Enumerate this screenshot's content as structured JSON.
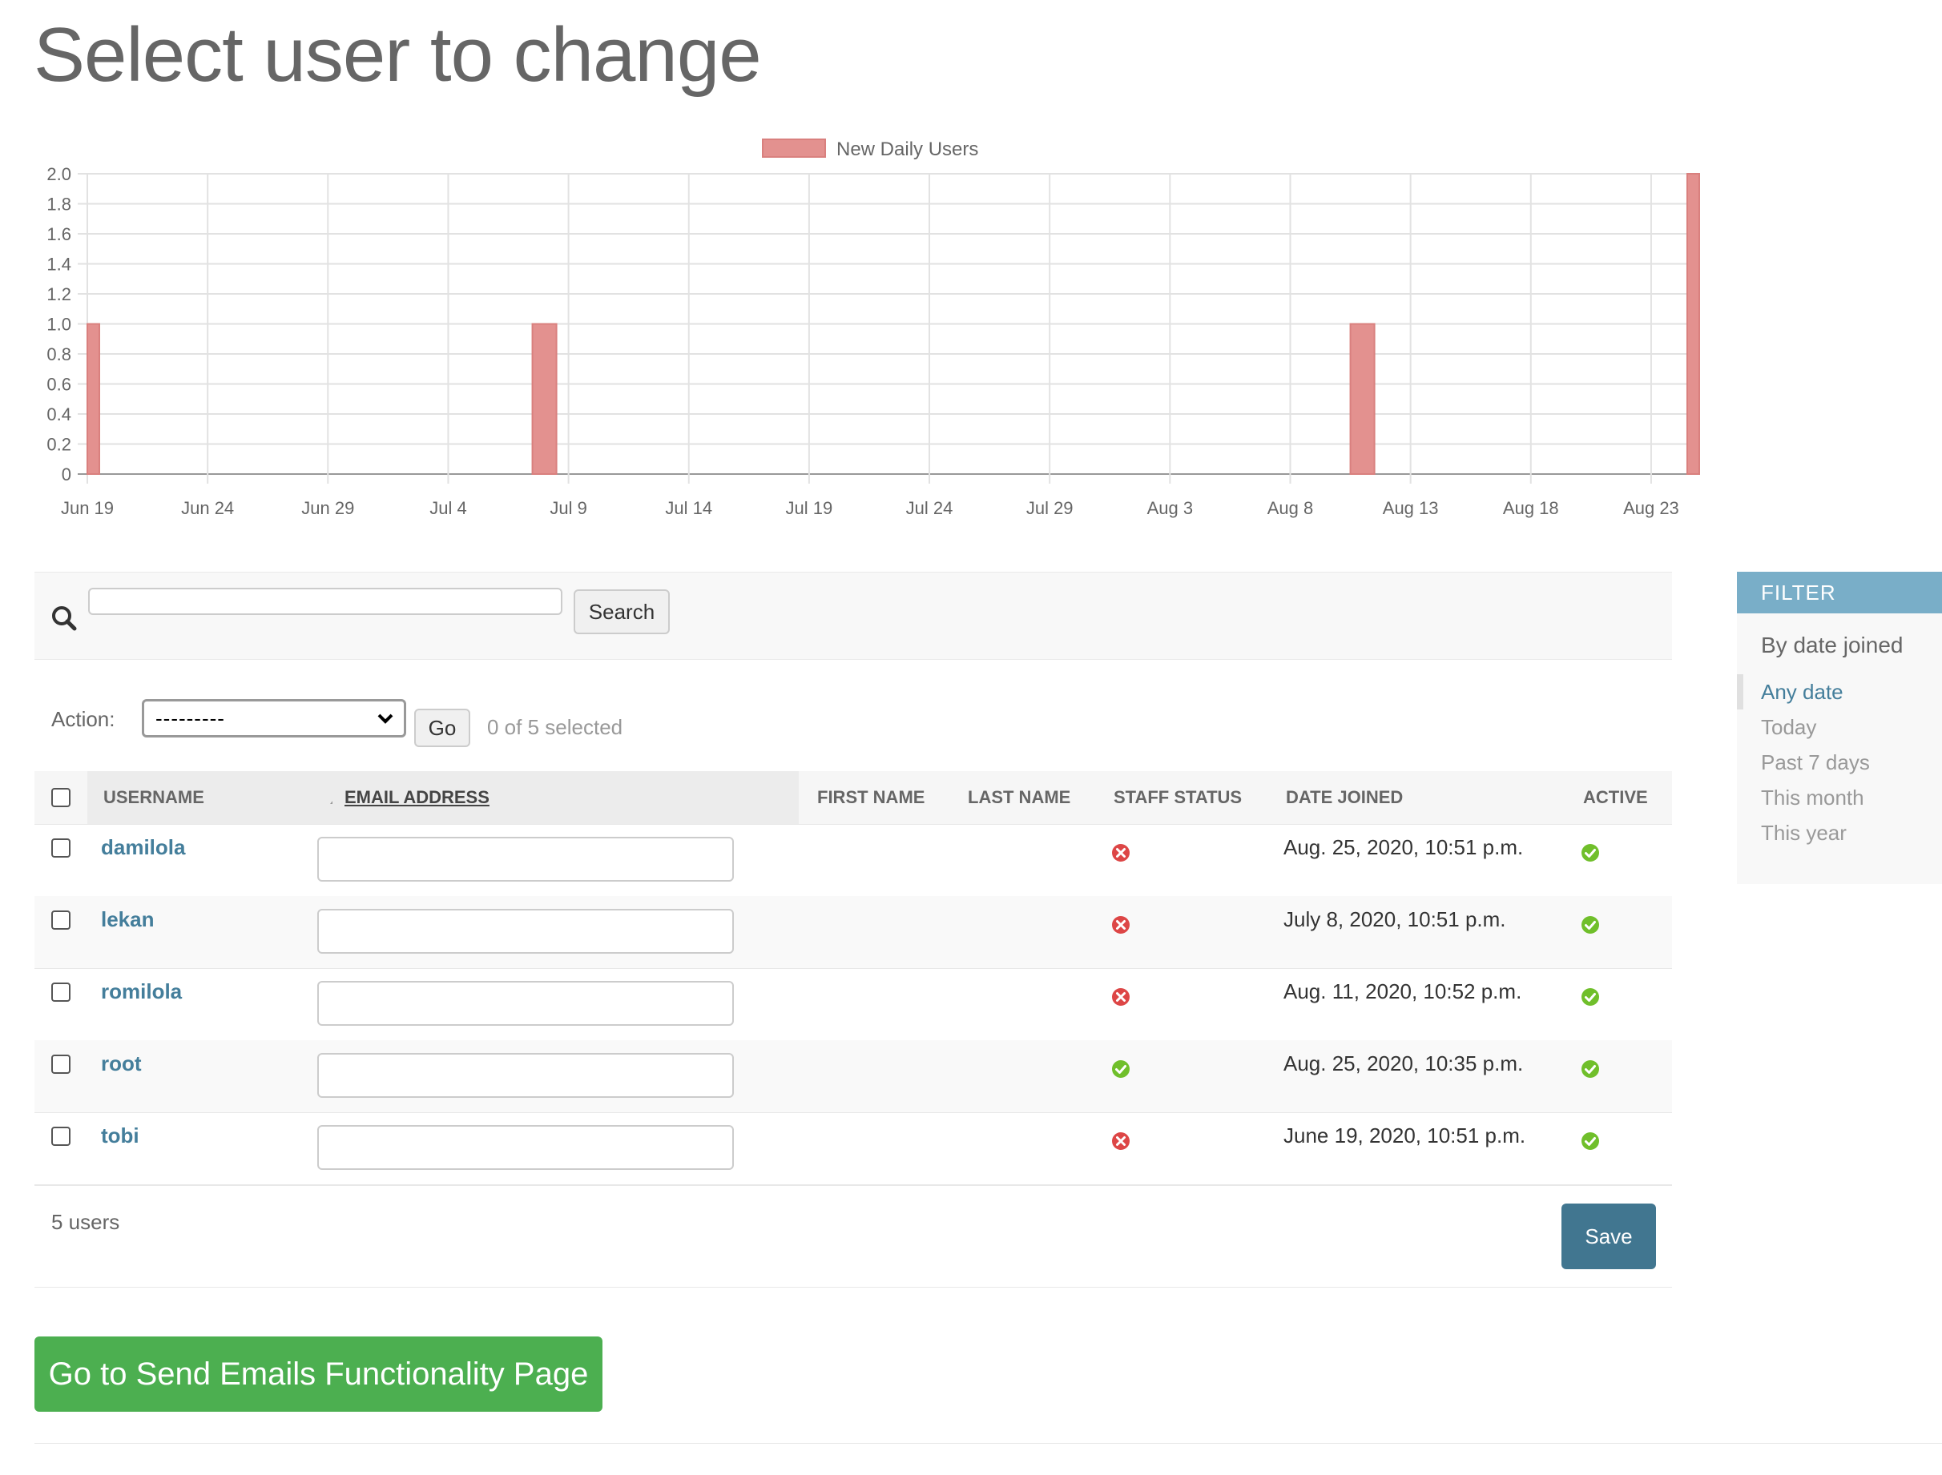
{
  "page": {
    "title": "Select user to change"
  },
  "chart_data": {
    "type": "bar",
    "title": "",
    "legend": [
      "New Daily Users"
    ],
    "legend_position": "top-center",
    "x_tick_labels": [
      "Jun 19",
      "Jun 24",
      "Jun 29",
      "Jul 4",
      "Jul 9",
      "Jul 14",
      "Jul 19",
      "Jul 24",
      "Jul 29",
      "Aug 3",
      "Aug 8",
      "Aug 13",
      "Aug 18",
      "Aug 23"
    ],
    "y_tick_labels": [
      "0",
      "0.2",
      "0.4",
      "0.6",
      "0.8",
      "1.0",
      "1.2",
      "1.4",
      "1.6",
      "1.8",
      "2.0"
    ],
    "ylim": [
      0,
      2.0
    ],
    "grid": true,
    "color": "#e3918f",
    "series": [
      {
        "name": "New Daily Users",
        "points": [
          {
            "x": "Jun 19",
            "y": 1
          },
          {
            "x": "Jul 8",
            "y": 1
          },
          {
            "x": "Aug 11",
            "y": 1
          },
          {
            "x": "Aug 25",
            "y": 2
          }
        ]
      }
    ]
  },
  "search": {
    "button_label": "Search",
    "value": ""
  },
  "actions": {
    "label": "Action:",
    "selected": "---------",
    "go_label": "Go",
    "selection_text": "0 of 5 selected"
  },
  "table": {
    "headers": {
      "username": "USERNAME",
      "email": "EMAIL ADDRESS",
      "first_name": "FIRST NAME",
      "last_name": "LAST NAME",
      "staff_status": "STAFF STATUS",
      "date_joined": "DATE JOINED",
      "active": "ACTIVE"
    },
    "rows": [
      {
        "username": "damilola",
        "email": "",
        "staff": false,
        "date_joined": "Aug. 25, 2020, 10:51 p.m.",
        "active": true
      },
      {
        "username": "lekan",
        "email": "",
        "staff": false,
        "date_joined": "July 8, 2020, 10:51 p.m.",
        "active": true
      },
      {
        "username": "romilola",
        "email": "",
        "staff": false,
        "date_joined": "Aug. 11, 2020, 10:52 p.m.",
        "active": true
      },
      {
        "username": "root",
        "email": "",
        "staff": true,
        "date_joined": "Aug. 25, 2020, 10:35 p.m.",
        "active": true
      },
      {
        "username": "tobi",
        "email": "",
        "staff": false,
        "date_joined": "June 19, 2020, 10:51 p.m.",
        "active": true
      }
    ],
    "count_text": "5 users",
    "save_label": "Save"
  },
  "send_emails_button": "Go to Send Emails Functionality Page",
  "filter": {
    "heading": "FILTER",
    "subheading": "By date joined",
    "options": [
      "Any date",
      "Today",
      "Past 7 days",
      "This month",
      "This year"
    ],
    "selected": "Any date"
  },
  "colors": {
    "link": "#447e9b",
    "filter_header": "#79aec8",
    "save": "#417690",
    "green_button": "#4caf50",
    "no_icon": "#dd4646",
    "yes_icon": "#70bf2b"
  }
}
